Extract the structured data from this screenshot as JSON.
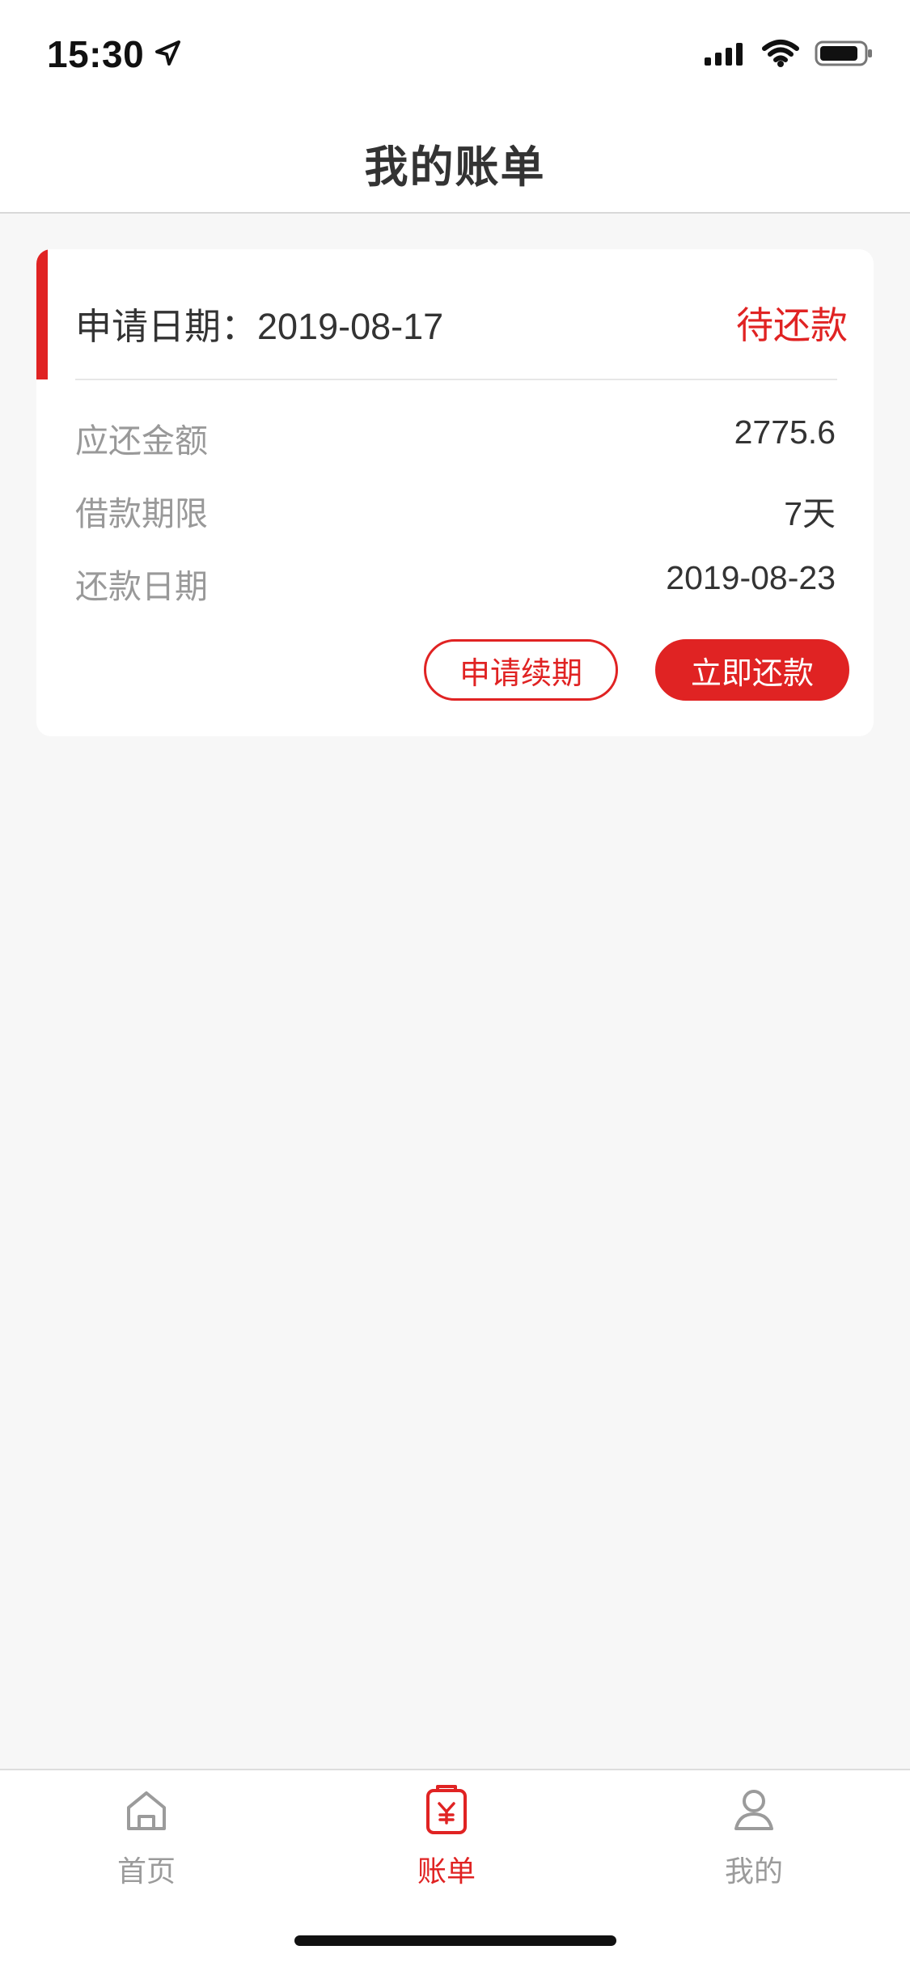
{
  "status_bar": {
    "time": "15:30",
    "icons": [
      "location-arrow-icon",
      "signal-icon",
      "wifi-icon",
      "battery-icon"
    ]
  },
  "nav": {
    "title": "我的账单"
  },
  "bill": {
    "apply_date_text": "申请日期：2019-08-17",
    "status": "待还款",
    "rows": [
      {
        "label": "应还金额",
        "value": "2775.6"
      },
      {
        "label": "借款期限",
        "value": "7天"
      },
      {
        "label": "还款日期",
        "value": "2019-08-23"
      }
    ],
    "buttons": {
      "renew": "申请续期",
      "repay": "立即还款"
    }
  },
  "tabbar": {
    "items": [
      {
        "label": "首页",
        "icon": "home-icon",
        "active": false
      },
      {
        "label": "账单",
        "icon": "bill-icon",
        "active": true
      },
      {
        "label": "我的",
        "icon": "profile-icon",
        "active": false
      }
    ]
  },
  "colors": {
    "accent": "#e02323",
    "background": "#f7f7f7",
    "card": "#ffffff",
    "muted_text": "#999999",
    "primary_text": "#333333"
  }
}
